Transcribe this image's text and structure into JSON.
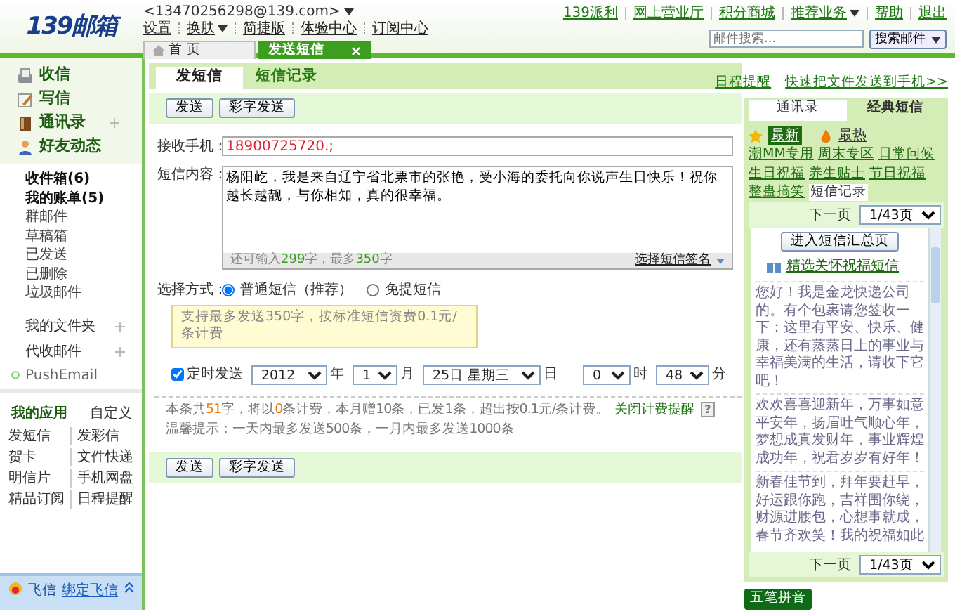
{
  "header": {
    "logo": "139邮箱",
    "account": "<13470256298@139.com>",
    "nav": [
      {
        "label": "设置",
        "dropdown": false
      },
      {
        "label": "换肤",
        "dropdown": true
      },
      {
        "label": "简捷版",
        "dropdown": false
      },
      {
        "label": "体验中心",
        "dropdown": false
      },
      {
        "label": "订阅中心",
        "dropdown": false
      }
    ],
    "top_links": [
      {
        "label": "139派利",
        "dropdown": false
      },
      {
        "label": "网上营业厅",
        "dropdown": false
      },
      {
        "label": "积分商城",
        "dropdown": false
      },
      {
        "label": "推荐业务",
        "dropdown": true
      },
      {
        "label": "帮助",
        "dropdown": false
      },
      {
        "label": "退出",
        "dropdown": false
      }
    ],
    "search": {
      "placeholder": "邮件搜索...",
      "button": "搜索邮件"
    }
  },
  "page_tabs": [
    {
      "label": "首 页",
      "selected": false
    },
    {
      "label": "发送短信",
      "selected": true
    }
  ],
  "sidebar": {
    "main_items": [
      {
        "label": "收信",
        "kind": "inbox"
      },
      {
        "label": "写信",
        "kind": "write"
      },
      {
        "label": "通讯录",
        "kind": "contacts"
      },
      {
        "label": "好友动态",
        "kind": "friends"
      }
    ],
    "folders": [
      {
        "label": "收件箱(6)",
        "unread": true
      },
      {
        "label": "我的账单(5)",
        "unread": true
      },
      {
        "label": "群邮件",
        "unread": false
      },
      {
        "label": "草稿箱",
        "unread": false
      },
      {
        "label": "已发送",
        "unread": false
      },
      {
        "label": "已删除",
        "unread": false
      },
      {
        "label": "垃圾邮件",
        "unread": false
      }
    ],
    "groups": [
      "我的文件夹",
      "代收邮件"
    ],
    "push": "PushEmail",
    "apps_title": "我的应用",
    "customize": "自定义",
    "apps": [
      "发短信",
      "发彩信",
      "贺卡",
      "文件快递",
      "明信片",
      "手机网盘",
      "精品订阅",
      "日程提醒"
    ],
    "feixin": {
      "label": "飞信",
      "link": "绑定飞信"
    }
  },
  "sms": {
    "tabs": [
      {
        "label": "发短信",
        "selected": true
      },
      {
        "label": "短信记录",
        "selected": false
      }
    ],
    "links": [
      "日程提醒",
      "快速把文件发送到手机>>"
    ],
    "buttons": [
      "发送",
      "彩字发送"
    ],
    "buttons_bottom": [
      "发送",
      "彩字发送"
    ],
    "recipient_label": "接收手机：",
    "recipient": "18900725720.;",
    "content_label": "短信内容：",
    "content": "杨阳屹，我是来自辽宁省北票市的张艳，受小海的委托向你说声生日快乐！祝你越长越靓，与你相知，真的很幸福。",
    "counter": [
      {
        "text": "还可输入",
        "em": false
      },
      {
        "text": "299",
        "em": true
      },
      {
        "text": "字，最多",
        "em": false
      },
      {
        "text": "350",
        "em": true
      },
      {
        "text": "字",
        "em": false
      }
    ],
    "signature": "选择短信签名",
    "mode_label": "选择方式：",
    "modes": [
      {
        "label": "普通短信（推荐）",
        "selected": true
      },
      {
        "label": "免提短信",
        "selected": false
      }
    ],
    "tip": "支持最多发送350字，按标准短信资费0.1元/条计费",
    "schedule": {
      "checked": true,
      "label": "定时发送",
      "fields": [
        {
          "value": "2012",
          "unit": "年"
        },
        {
          "value": "1",
          "unit": "月"
        },
        {
          "value": "25日 星期三",
          "unit": "日"
        },
        {
          "value": "0",
          "unit": "时"
        },
        {
          "value": "48",
          "unit": "分"
        }
      ]
    },
    "summary": [
      {
        "text": "本条共",
        "em": false
      },
      {
        "text": "51",
        "em": true
      },
      {
        "text": "字，将以",
        "em": false
      },
      {
        "text": "0",
        "em": true
      },
      {
        "text": "条计费，本月赠10条，已发1条，超出按0.1元/条计费。",
        "em": false
      }
    ],
    "summary_link": "关闭计费提醒",
    "help": "?",
    "notice": "温馨提示：一天内最多发送500条，一月内最多发送1000条"
  },
  "right_panel": {
    "tabs": [
      {
        "label": "通讯录",
        "selected": false
      },
      {
        "label": "经典短信",
        "selected": true
      }
    ],
    "filters": [
      {
        "label": "最新",
        "selected": true,
        "kind": "star"
      },
      {
        "label": "最热",
        "selected": false,
        "kind": "flame"
      }
    ],
    "categories": [
      {
        "label": "潮MM专用",
        "selected": false
      },
      {
        "label": "周末专区",
        "selected": false
      },
      {
        "label": "日常问候",
        "selected": false
      },
      {
        "label": "生日祝福",
        "selected": false
      },
      {
        "label": "养生贴士",
        "selected": false
      },
      {
        "label": "节日祝福",
        "selected": false
      },
      {
        "label": "整蛊搞笑",
        "selected": false
      },
      {
        "label": "短信记录",
        "selected": true
      }
    ],
    "pager": {
      "next": "下一页",
      "page": "1/43页"
    },
    "summary_button": "进入短信汇总页",
    "featured_link": "精选关怀祝福短信",
    "messages": [
      "您好！我是金龙快递公司的。有个包裹请您签收一下：这里有平安、快乐、健康，还有蒸蒸日上的事业与幸福美满的生活，请收下它吧！",
      "欢欢喜喜迎新年，万事如意平安年，扬眉吐气顺心年，梦想成真发财年，事业辉煌成功年，祝君岁岁有好年！",
      "新春佳节到，拜年要赶早，好运跟你跑，吉祥围你绕，财源进腰包，心想事就成，春节齐欢笑！我的祝福如此"
    ],
    "pager_bottom": {
      "next": "下一页",
      "page": "1/43页"
    },
    "ime": "五笔拼音"
  }
}
